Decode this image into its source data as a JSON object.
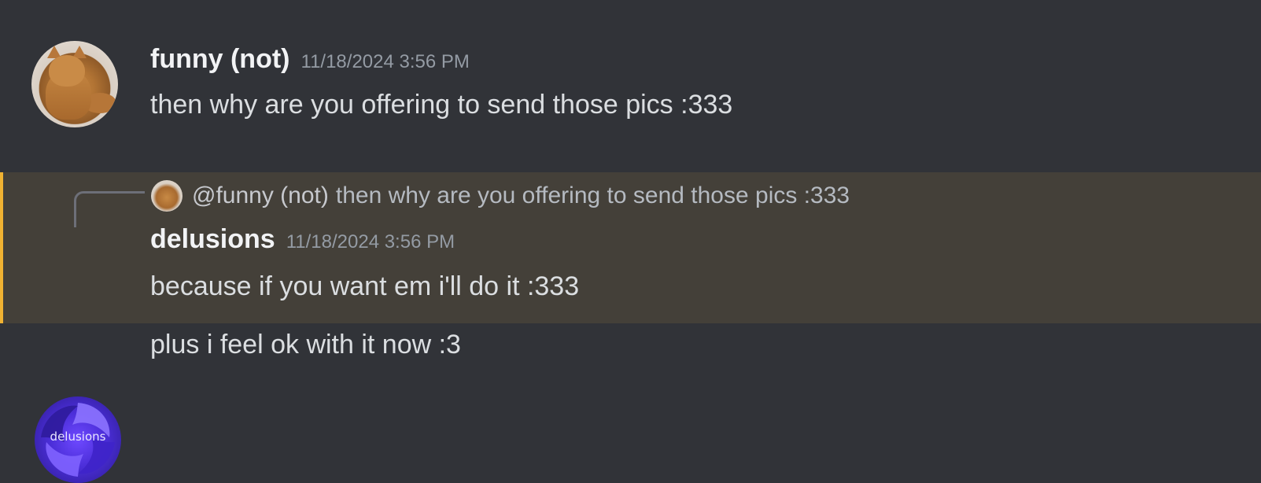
{
  "messages": [
    {
      "author": "funny (not)",
      "timestamp": "11/18/2024 3:56 PM",
      "text": "then why are you offering to send those pics :333",
      "avatar_icon": "orange-cat-avatar"
    },
    {
      "author": "delusions",
      "timestamp": "11/18/2024 3:56 PM",
      "text": "because if you want em i'll do it :333",
      "avatar_icon": "purple-swirl-avatar",
      "avatar_label": "delusions",
      "highlighted": true,
      "reply": {
        "mention": "@funny (not)",
        "text": "then why are you offering to send those pics :333"
      }
    },
    {
      "text": "plus i feel ok with it now :3"
    }
  ],
  "colors": {
    "background": "#313338",
    "highlight_background": "#444039",
    "highlight_border": "#f0b232",
    "username": "#f2f3f5",
    "timestamp": "#949ba4",
    "text": "#dbdee1"
  }
}
